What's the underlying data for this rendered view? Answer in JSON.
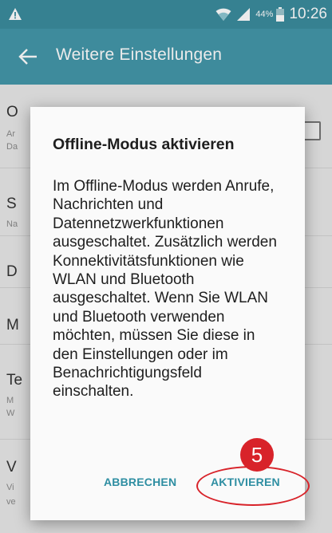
{
  "status_bar": {
    "battery_percent": "44%",
    "time": "10:26"
  },
  "action_bar": {
    "title": "Weitere Einstellungen"
  },
  "background_list": [
    {
      "title": "O",
      "sub1": "Ar",
      "sub2": "Da"
    },
    {
      "title": "S",
      "sub1": "Na"
    },
    {
      "title": "D"
    },
    {
      "title": "M"
    },
    {
      "title": "Te",
      "sub1": "M",
      "sub2": "W"
    },
    {
      "title": "V",
      "sub1": "Vi",
      "sub2": "ve"
    }
  ],
  "dialog": {
    "title": "Offline-Modus aktivieren",
    "body": "Im Offline-Modus werden Anrufe, Nachrichten und Datennetzwerkfunktionen ausgeschaltet. Zusätzlich werden Konnektivitätsfunktionen wie WLAN und Bluetooth ausgeschaltet. Wenn Sie WLAN und Bluetooth verwenden möchten, müssen Sie diese in den Einstellungen oder im Benachrichtigungsfeld einschalten.",
    "cancel_label": "ABBRECHEN",
    "activate_label": "AKTIVIEREN"
  },
  "annotation": {
    "step_number": "5"
  },
  "colors": {
    "status_bar": "#3b8c9e",
    "action_bar": "#4497aa",
    "button_text": "#2e8ea2",
    "annotation_red": "#d8232a"
  }
}
